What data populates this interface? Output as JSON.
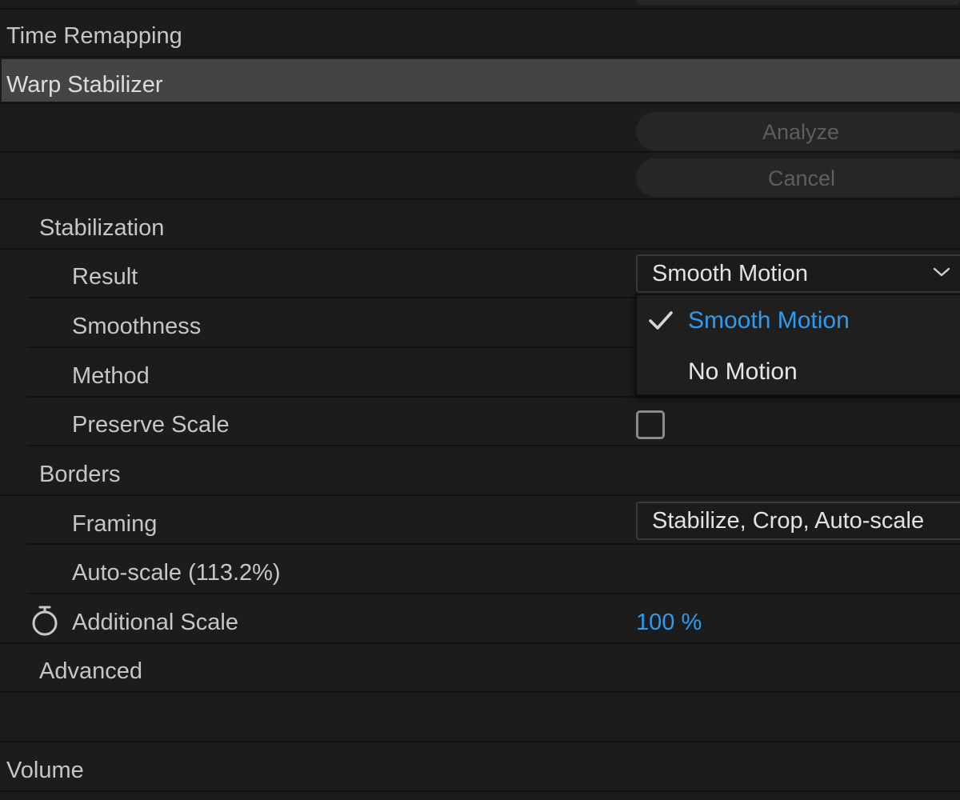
{
  "effects": {
    "time_remapping": "Time Remapping",
    "warp_stabilizer": "Warp Stabilizer",
    "volume": "Volume"
  },
  "warp_stabilizer": {
    "analyze_label": "Analyze",
    "cancel_label": "Cancel",
    "stabilization": {
      "group_label": "Stabilization",
      "result_label": "Result",
      "result_value": "Smooth Motion",
      "smoothness_label": "Smoothness",
      "method_label": "Method",
      "preserve_scale_label": "Preserve Scale",
      "preserve_scale_checked": false
    },
    "borders": {
      "group_label": "Borders",
      "framing_label": "Framing",
      "framing_value": "Stabilize, Crop, Auto-scale",
      "auto_scale_label": "Auto-scale (113.2%)",
      "additional_scale_label": "Additional Scale",
      "additional_scale_value": "100 %"
    },
    "advanced_label": "Advanced"
  },
  "result_menu": {
    "items": [
      {
        "label": "Smooth Motion",
        "selected": true
      },
      {
        "label": "No Motion",
        "selected": false
      }
    ]
  },
  "colors": {
    "accent_blue": "#2d9cf0",
    "panel_bg": "#1c1c1c",
    "selected_row_bg": "#444444"
  },
  "icons": {
    "dropdown": "chevron-down-icon",
    "selected_mark": "checkmark-icon",
    "keyframe_toggle": "stopwatch-icon"
  }
}
